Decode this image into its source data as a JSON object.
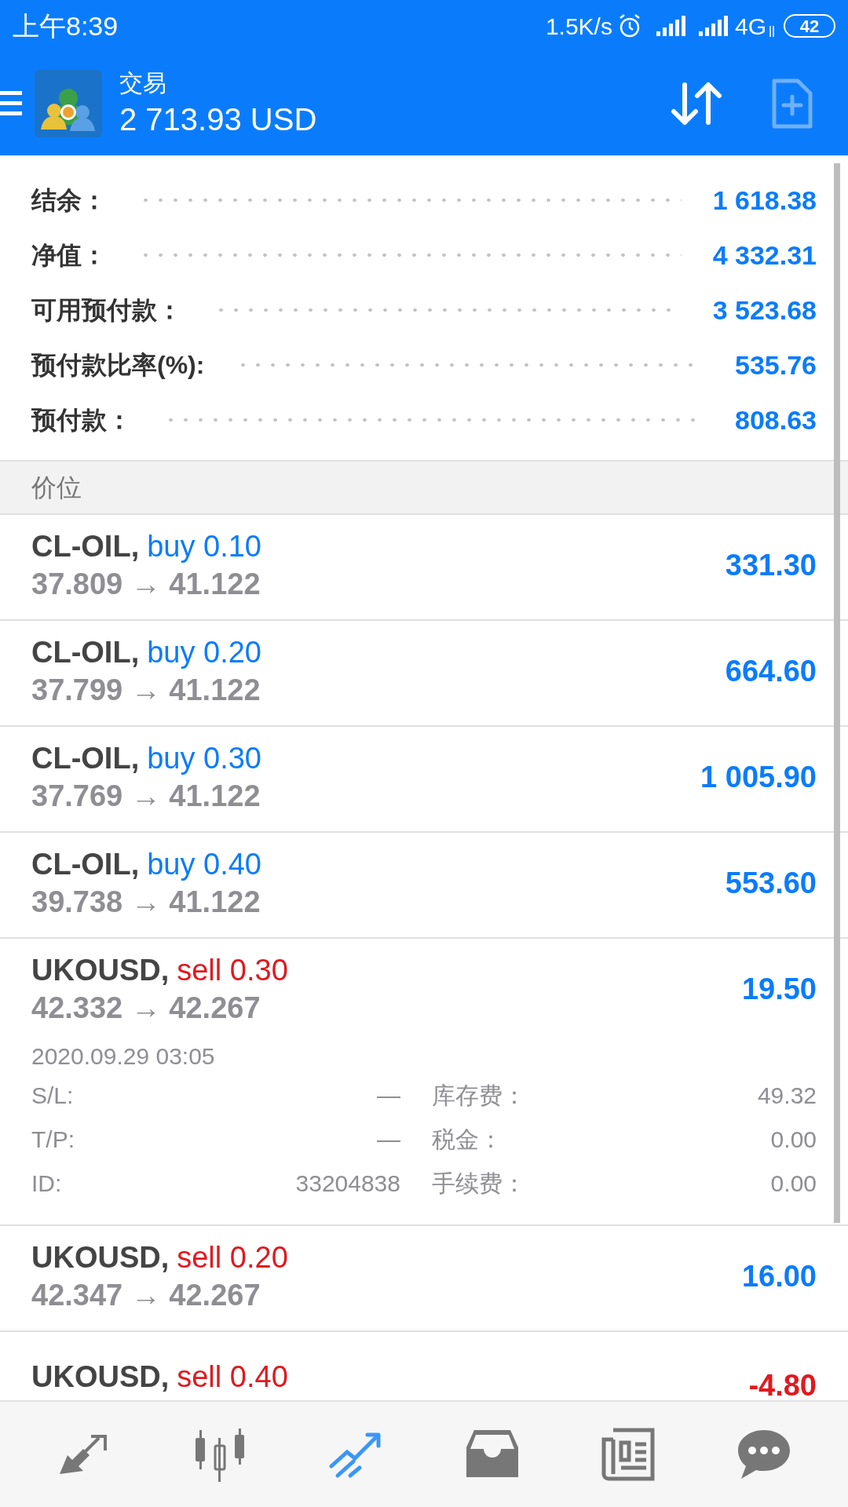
{
  "status_bar": {
    "time": "上午8:39",
    "net_speed": "1.5K/s",
    "network": "4G",
    "battery": "42"
  },
  "header": {
    "title": "交易",
    "balance": "2 713.93 USD"
  },
  "summary": [
    {
      "label": "结余：",
      "value": "1 618.38"
    },
    {
      "label": "净值：",
      "value": "4 332.31"
    },
    {
      "label": "可用预付款：",
      "value": "3 523.68"
    },
    {
      "label": "预付款比率(%):",
      "value": "535.76"
    },
    {
      "label": "预付款：",
      "value": "808.63"
    }
  ],
  "section_title": "价位",
  "positions": [
    {
      "symbol": "CL-OIL,",
      "kind": "buy",
      "order": "buy 0.10",
      "prices": "37.809 → 41.122",
      "profit": "331.30",
      "loss": false,
      "expanded": false
    },
    {
      "symbol": "CL-OIL,",
      "kind": "buy",
      "order": "buy 0.20",
      "prices": "37.799 → 41.122",
      "profit": "664.60",
      "loss": false,
      "expanded": false
    },
    {
      "symbol": "CL-OIL,",
      "kind": "buy",
      "order": "buy 0.30",
      "prices": "37.769 → 41.122",
      "profit": "1 005.90",
      "loss": false,
      "expanded": false
    },
    {
      "symbol": "CL-OIL,",
      "kind": "buy",
      "order": "buy 0.40",
      "prices": "39.738 → 41.122",
      "profit": "553.60",
      "loss": false,
      "expanded": false
    },
    {
      "symbol": "UKOUSD,",
      "kind": "sell",
      "order": "sell 0.30",
      "prices": "42.332 → 42.267",
      "profit": "19.50",
      "loss": false,
      "expanded": true,
      "time": "2020.09.29 03:05",
      "details": [
        [
          "S/L:",
          "—",
          "库存费：",
          "49.32"
        ],
        [
          "T/P:",
          "—",
          "税金：",
          "0.00"
        ],
        [
          "ID:",
          "33204838",
          "手续费：",
          "0.00"
        ]
      ]
    },
    {
      "symbol": "UKOUSD,",
      "kind": "sell",
      "order": "sell 0.20",
      "prices": "42.347 → 42.267",
      "profit": "16.00",
      "loss": false,
      "expanded": false
    },
    {
      "symbol": "UKOUSD,",
      "kind": "sell",
      "order": "sell 0.40",
      "profit": "-4.80",
      "loss": true,
      "expanded": false
    }
  ],
  "bottom_nav": [
    {
      "selected": false
    },
    {
      "selected": false
    },
    {
      "selected": true
    },
    {
      "selected": false
    },
    {
      "selected": false
    },
    {
      "selected": false
    }
  ]
}
